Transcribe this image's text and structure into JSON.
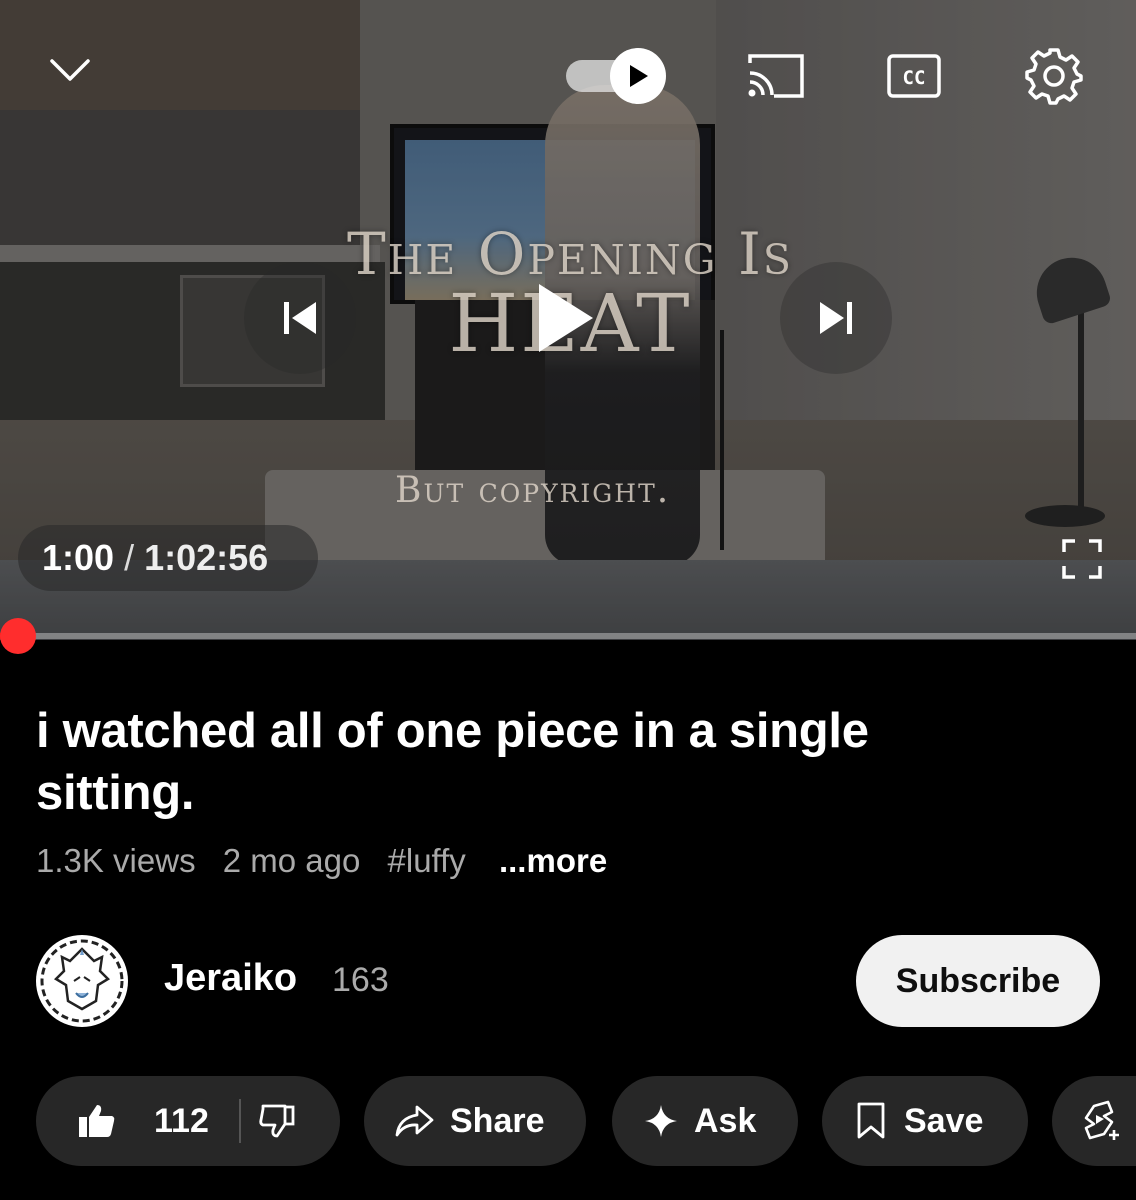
{
  "video": {
    "overlay_line1": "The Opening Is",
    "overlay_line2": "HEAT",
    "overlay_sub": "But copyright.",
    "current_time": "1:00",
    "time_separator": "/",
    "duration": "1:02:56",
    "progress_fraction": 0.016,
    "autoplay_on": true
  },
  "icons": {
    "collapse": "chevron-down-icon",
    "autoplay": "autoplay-toggle",
    "cast": "cast-icon",
    "captions": "cc-icon",
    "settings": "gear-icon",
    "previous": "skip-previous-icon",
    "play": "play-icon",
    "next": "skip-next-icon",
    "fullscreen": "fullscreen-icon"
  },
  "details": {
    "title": "i watched all of one piece in a single sitting.",
    "views": "1.3K views",
    "age": "2 mo ago",
    "hashtag": "#luffy",
    "more": "...more"
  },
  "channel": {
    "name": "Jeraiko",
    "subscribers": "163",
    "subscribe_label": "Subscribe"
  },
  "actions": {
    "likes": "112",
    "share_label": "Share",
    "ask_label": "Ask",
    "save_label": "Save"
  },
  "colors": {
    "progress": "#ff0000",
    "pill_bg": "#272727",
    "subscribe_bg": "#f1f1f1"
  }
}
